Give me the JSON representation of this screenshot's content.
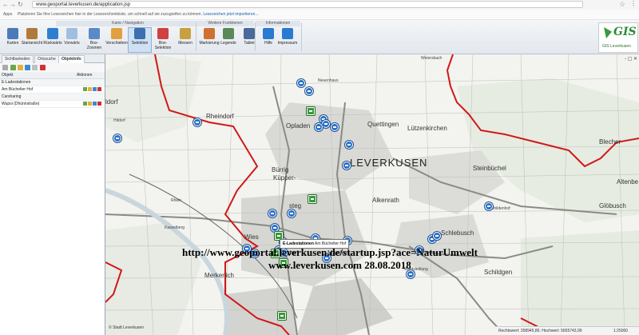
{
  "browser": {
    "url": "www.geoportal.leverkusen.de/application.jsp",
    "bookmarks_apps": "Apps",
    "bookmarks_text": "Platzieren Sie Ihre Lesezeichen hier in der Lesezeichenleiste, um schnell auf sie zuzugreifen zu können.",
    "bookmarks_link": "Lesezeichen jetzt importieren..."
  },
  "ribbon": {
    "groups": {
      "navigation": "Karte / Navigation",
      "more": "Weitere Funktionen",
      "info": "Informationen"
    },
    "tools": [
      {
        "label": "Karten",
        "color": "#4a7ab8"
      },
      {
        "label": "Startansicht",
        "color": "#b07a3a"
      },
      {
        "label": "Rückwärts",
        "color": "#2f7fd0"
      },
      {
        "label": "Vorwärts",
        "color": "#9fbfe0"
      },
      {
        "label": "Box-Zoomen",
        "color": "#5a8ac8"
      },
      {
        "label": "Verschieben",
        "color": "#e0a040"
      },
      {
        "label": "Selektion",
        "color": "#3c6fb0"
      },
      {
        "label": "Box-Selektion",
        "color": "#d04040"
      },
      {
        "label": "Messen",
        "color": "#c8a040"
      },
      {
        "label": "Markierung",
        "color": "#d07030"
      },
      {
        "label": "Legende",
        "color": "#5a8a5a"
      },
      {
        "label": "Tablet",
        "color": "#4a6a9a"
      },
      {
        "label": "Hilfe",
        "color": "#2a7ad0"
      },
      {
        "label": "Impressum",
        "color": "#2a7ad0"
      }
    ],
    "logo_text": "GIS",
    "logo_sub": "GIS Leverkusen"
  },
  "panel": {
    "tabs": [
      "Sichtbarkeiten",
      "Ortssuche",
      "Objektinfo"
    ],
    "header": {
      "object": "Objekt",
      "actions": "Aktionen"
    },
    "rows": [
      {
        "text": "E-Ladestationen",
        "group": true
      },
      {
        "text": "Am Büchelter Hof",
        "group": false
      },
      {
        "text": "Carsharing",
        "group": true
      },
      {
        "text": "Wupsi (Dhünnstraße)",
        "group": false
      }
    ]
  },
  "map": {
    "labels": {
      "rheindorf": "Rheindorf",
      "opladen": "Opladen",
      "quettingen": "Quettingen",
      "luetzenkirchen": "Lützenkirchen",
      "leverkusen": "LEVERKUSEN",
      "buerrig": "Bürrig",
      "kueppersteg": "Küpper-",
      "steg": "steg",
      "alkenrath": "Alkenrath",
      "steinbuechel": "Steinbüchel",
      "mathildenhof": "Mathildenhof",
      "gloebusch": "Glöbusch",
      "altenberg": "Altenbe",
      "blecher": "Blecher",
      "schlebusch": "Schlebusch",
      "manfort": "Manfort",
      "wiesdorf": "Wies",
      "dorf": "dorf",
      "merkenich": "Merkenich",
      "kasselberg": "Kasselberg",
      "schildgen": "Schildgen",
      "waldsiedlung": "Waldsiedlung",
      "ldorf": "ldorf",
      "hitdorf": "Hitdorf",
      "rhein": "Rhein",
      "neuenhaus": "Neuenhaus",
      "weiersbach": "Weiersbach"
    },
    "tooltip_title": "E-Ladestationen",
    "tooltip_value": "Am Büchelter Hof",
    "zoom_controls": "- ▢ ✕",
    "copyright": "© Stadt Leverkusen",
    "status_right": "Rechtswert: 358945,86; Hochwert: 5655743,99",
    "status_scale": "1:25000"
  },
  "overlay": {
    "line1": "http://www.geoportal.leverkusen.de/startup.jsp?ace=NaturUmwelt",
    "line2": "www.leverkusen.com 28.08.2018"
  },
  "colors": {
    "boundary": "#d01818",
    "charging_pin": "#2a72c9",
    "carsharing_pin": "#3a9a3a"
  }
}
